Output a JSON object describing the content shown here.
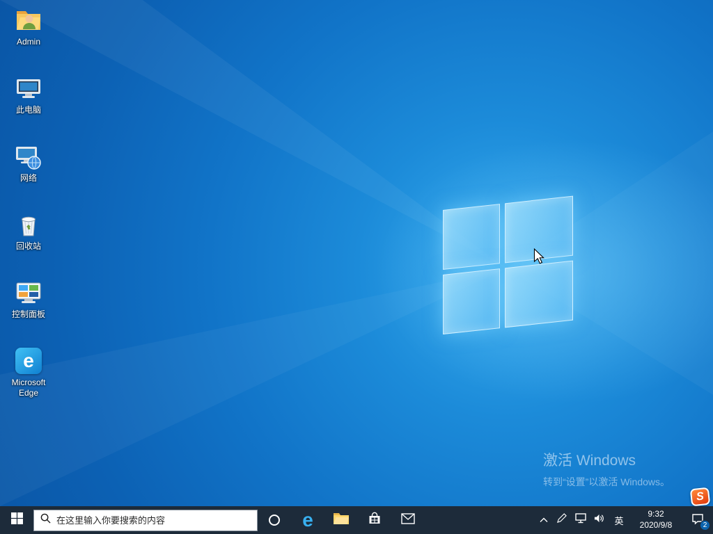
{
  "desktop": {
    "icons": [
      {
        "label": "Admin"
      },
      {
        "label": "此电脑"
      },
      {
        "label": "网络"
      },
      {
        "label": "回收站"
      },
      {
        "label": "控制面板"
      },
      {
        "label": "Microsoft Edge"
      }
    ],
    "activation": {
      "title": "激活 Windows",
      "subtitle": "转到“设置”以激活 Windows。"
    }
  },
  "taskbar": {
    "search_placeholder": "在这里输入你要搜索的内容",
    "ime_indicator": "英",
    "clock": {
      "time": "9:32",
      "date": "2020/9/8"
    },
    "action_center_badge": "2"
  },
  "glyphs": {
    "edge": "e",
    "sogou": "S"
  },
  "colors": {
    "taskbar_bg": "#1d2b3a",
    "wallpaper_blue": "#1174c8",
    "accent_blue": "#0078d7",
    "edge_blue": "#38b0f0",
    "folder_yellow": "#ffd76e",
    "sogou_red": "#e23a0c"
  }
}
